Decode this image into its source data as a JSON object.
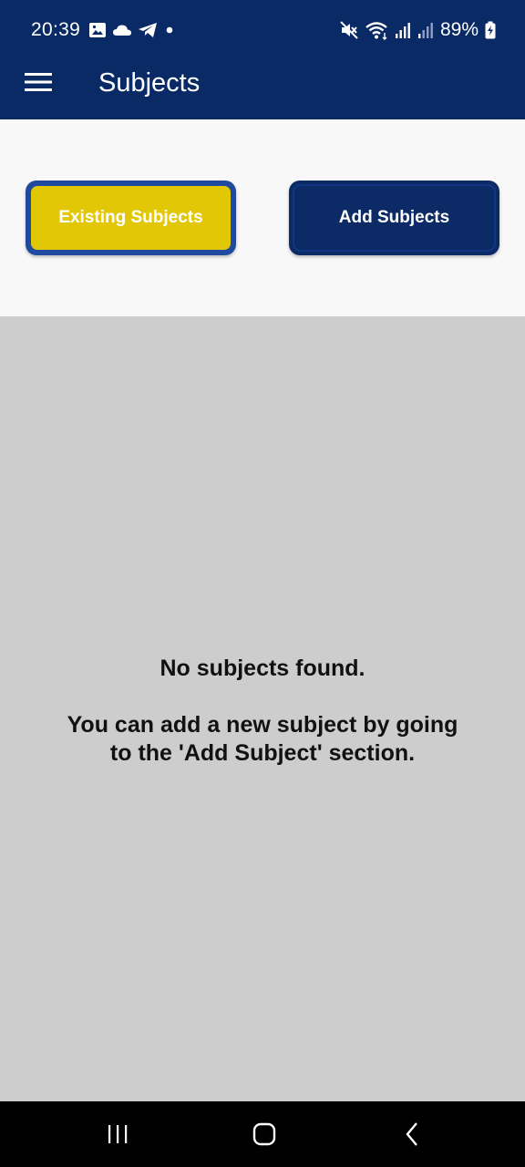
{
  "status_bar": {
    "time": "20:39",
    "battery_percent": "89%",
    "left_icons": [
      "gallery-icon",
      "cloud-icon",
      "telegram-icon",
      "dot-icon"
    ],
    "right_icons": [
      "mute-icon",
      "wifi-icon",
      "signal-icon",
      "signal-icon",
      "battery-charging-icon"
    ]
  },
  "app_bar": {
    "title": "Subjects",
    "menu_icon": "hamburger-menu-icon"
  },
  "segments": {
    "existing_label": "Existing Subjects",
    "add_label": "Add Subjects",
    "selected": "existing"
  },
  "empty_state": {
    "title": "No subjects found.",
    "hint": "You can add a new subject by going to the 'Add Subject' section."
  },
  "nav_bar": {
    "icons": [
      "recent-apps-icon",
      "home-icon",
      "back-icon"
    ]
  },
  "colors": {
    "primary": "#0a2a66",
    "accent_selected": "#e2c707",
    "selected_border": "#1f4a9e",
    "content_background": "#cdcdcd",
    "segment_background": "#f8f8f8"
  }
}
